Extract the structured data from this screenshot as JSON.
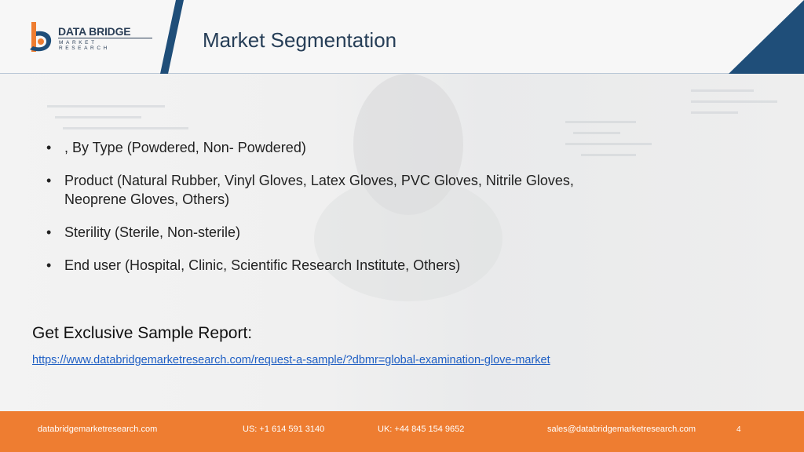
{
  "header": {
    "logo_name": "DATA BRIDGE",
    "logo_sub": "MARKET RESEARCH",
    "title": "Market Segmentation"
  },
  "bullets": [
    ", By Type (Powdered, Non- Powdered)",
    "Product (Natural Rubber, Vinyl Gloves, Latex Gloves, PVC Gloves, Nitrile Gloves, Neoprene Gloves, Others)",
    "Sterility (Sterile, Non-sterile)",
    "End user (Hospital, Clinic, Scientific Research Institute, Others)"
  ],
  "cta": {
    "heading": "Get Exclusive Sample Report:",
    "link": "https://www.databridgemarketresearch.com/request-a-sample/?dbmr=global-examination-glove-market"
  },
  "footer": {
    "website": "databridgemarketresearch.com",
    "us_phone": "US: +1 614 591 3140",
    "uk_phone": "UK: +44 845 154 9652",
    "email": "sales@databridgemarketresearch.com",
    "page_number": "4"
  },
  "colors": {
    "accent_orange": "#ee7d31",
    "navy": "#1f4e79",
    "link_blue": "#1f5fc4"
  }
}
